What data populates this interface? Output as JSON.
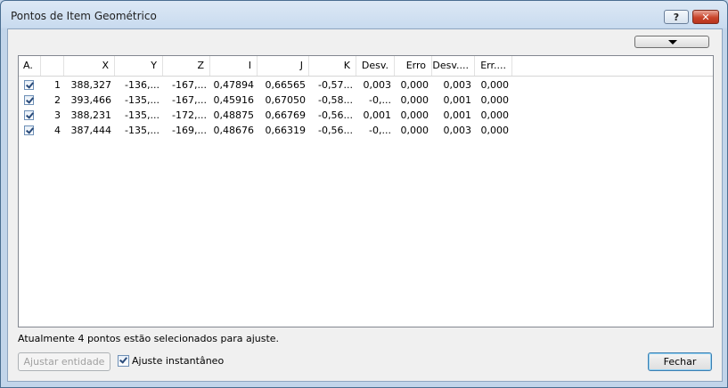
{
  "window": {
    "title": "Pontos de Item Geométrico",
    "help_label": "?",
    "close_label": "✕"
  },
  "columns": [
    "A.",
    "",
    "X",
    "Y",
    "Z",
    "I",
    "J",
    "K",
    "Desv.",
    "Erro",
    "Desv....",
    "Err...."
  ],
  "rows": [
    {
      "checked": true,
      "n": "1",
      "x": "388,327",
      "y": "-136,...",
      "z": "-167,...",
      "i": "0,47894",
      "j": "0,66565",
      "k": "-0,57...",
      "desv": "0,003",
      "erro": "0,000",
      "desv2": "0,003",
      "err2": "0,000"
    },
    {
      "checked": true,
      "n": "2",
      "x": "393,466",
      "y": "-135,...",
      "z": "-167,...",
      "i": "0,45916",
      "j": "0,67050",
      "k": "-0,58...",
      "desv": "-0,...",
      "erro": "0,000",
      "desv2": "0,001",
      "err2": "0,000"
    },
    {
      "checked": true,
      "n": "3",
      "x": "388,231",
      "y": "-135,...",
      "z": "-172,...",
      "i": "0,48875",
      "j": "0,66769",
      "k": "-0,56...",
      "desv": "0,001",
      "erro": "0,000",
      "desv2": "0,001",
      "err2": "0,000"
    },
    {
      "checked": true,
      "n": "4",
      "x": "387,444",
      "y": "-135,...",
      "z": "-169,...",
      "i": "0,48676",
      "j": "0,66319",
      "k": "-0,56...",
      "desv": "-0,...",
      "erro": "0,000",
      "desv2": "0,003",
      "err2": "0,000"
    }
  ],
  "status_text": "Atualmente 4 pontos estão selecionados para ajuste.",
  "buttons": {
    "adjust_entity": "Ajustar entidade",
    "close": "Fechar"
  },
  "instant_adjust": {
    "label": "Ajuste instantâneo",
    "checked": true
  },
  "icons": {
    "menu": "dropdown-arrow-icon",
    "check": "checkmark-icon"
  }
}
